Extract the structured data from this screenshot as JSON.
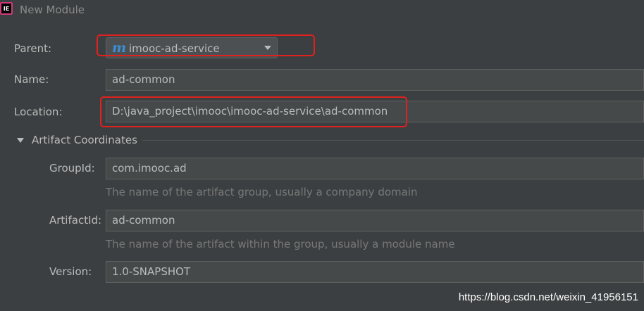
{
  "window": {
    "title": "New Module",
    "app_icon_text": "IE"
  },
  "form": {
    "parent": {
      "label": "Parent:",
      "value": "imooc-ad-service"
    },
    "name": {
      "label": "Name:",
      "value": "ad-common"
    },
    "location": {
      "label": "Location:",
      "value": "D:\\java_project\\imooc\\imooc-ad-service\\ad-common"
    },
    "artifact_section": {
      "title": "Artifact Coordinates"
    },
    "group_id": {
      "label": "GroupId:",
      "value": "com.imooc.ad",
      "hint": "The name of the artifact group, usually a company domain"
    },
    "artifact_id": {
      "label": "ArtifactId:",
      "value": "ad-common",
      "hint": "The name of the artifact within the group, usually a module name"
    },
    "version": {
      "label": "Version:",
      "value": "1.0-SNAPSHOT"
    }
  },
  "watermark": "https://blog.csdn.net/weixin_41956151",
  "colors": {
    "highlight": "#e0211d",
    "maven_icon": "#3c8fd6"
  }
}
